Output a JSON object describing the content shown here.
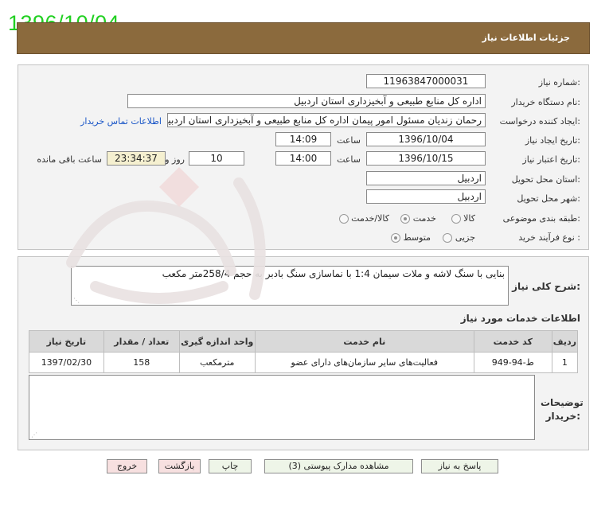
{
  "date_stamp": "1396/10/04",
  "header": {
    "title": "جزئیات اطلاعات نیاز"
  },
  "fields": {
    "need_number": {
      "label": "شماره نیاز:",
      "value": "11963847000031"
    },
    "buyer_org": {
      "label": "نام دستگاه خریدار:",
      "value": "اداره کل منابع طبیعی و آبخیزداری استان اردبیل"
    },
    "requester": {
      "label": "ایجاد کننده درخواست:",
      "value": "رحمان زندیان مسئول امور پیمان اداره کل منابع طبیعی و آبخیزداری استان اردبیل",
      "contact_link": "اطلاعات تماس خریدار"
    },
    "created": {
      "label": "تاریخ ایجاد نیاز:",
      "date": "1396/10/04",
      "time_label": "ساعت",
      "time": "14:09"
    },
    "validity": {
      "label": "تاریخ اعتبار نیاز:",
      "date": "1396/10/15",
      "time_label": "ساعت",
      "time": "14:00",
      "days": "10",
      "days_label": "روز و",
      "remaining": "23:34:37",
      "remaining_label": "ساعت باقی مانده"
    },
    "province": {
      "label": "استان محل تحویل:",
      "value": "اردبیل"
    },
    "city": {
      "label": "شهر محل تحویل:",
      "value": "اردبیل"
    },
    "category": {
      "label": "طبقه بندی موضوعی:",
      "options": [
        "کالا",
        "خدمت",
        "کالا/خدمت"
      ],
      "selected": "خدمت"
    },
    "purchase_type": {
      "label": "نوع فرآیند خرید :",
      "options": [
        "جزیی",
        "متوسط"
      ],
      "selected": "متوسط"
    }
  },
  "description": {
    "label": "شرح کلی نیاز:",
    "value": "بنایی با سنگ لاشه و ملات سیمان 1:4 با نماسازی سنگ بادبر به حجم 258/4متر مکعب"
  },
  "services": {
    "section_title": "اطلاعات خدمات مورد نیاز",
    "columns": [
      "ردیف",
      "کد خدمت",
      "نام خدمت",
      "واحد اندازه گیری",
      "تعداد / مقدار",
      "تاریخ نیاز"
    ],
    "rows": [
      [
        "1",
        "ط-94-949",
        "فعالیت‌های سایر سازمان‌های دارای عضو",
        "مترمکعب",
        "158",
        "1397/02/30"
      ]
    ]
  },
  "buyer_notes": {
    "label": "توضیحات خریدار:",
    "value": ""
  },
  "buttons": {
    "reply": "پاسخ به نیاز",
    "attachments": "مشاهده مدارک پیوستی (3)",
    "print": "چاپ",
    "back": "بازگشت",
    "exit": "خروج"
  },
  "colors": {
    "title_bar": "#8b6a3d",
    "date_stamp": "#22d022",
    "link": "#1a56c7",
    "button_green": "#eef5e8",
    "button_red": "#f7e0e0"
  }
}
